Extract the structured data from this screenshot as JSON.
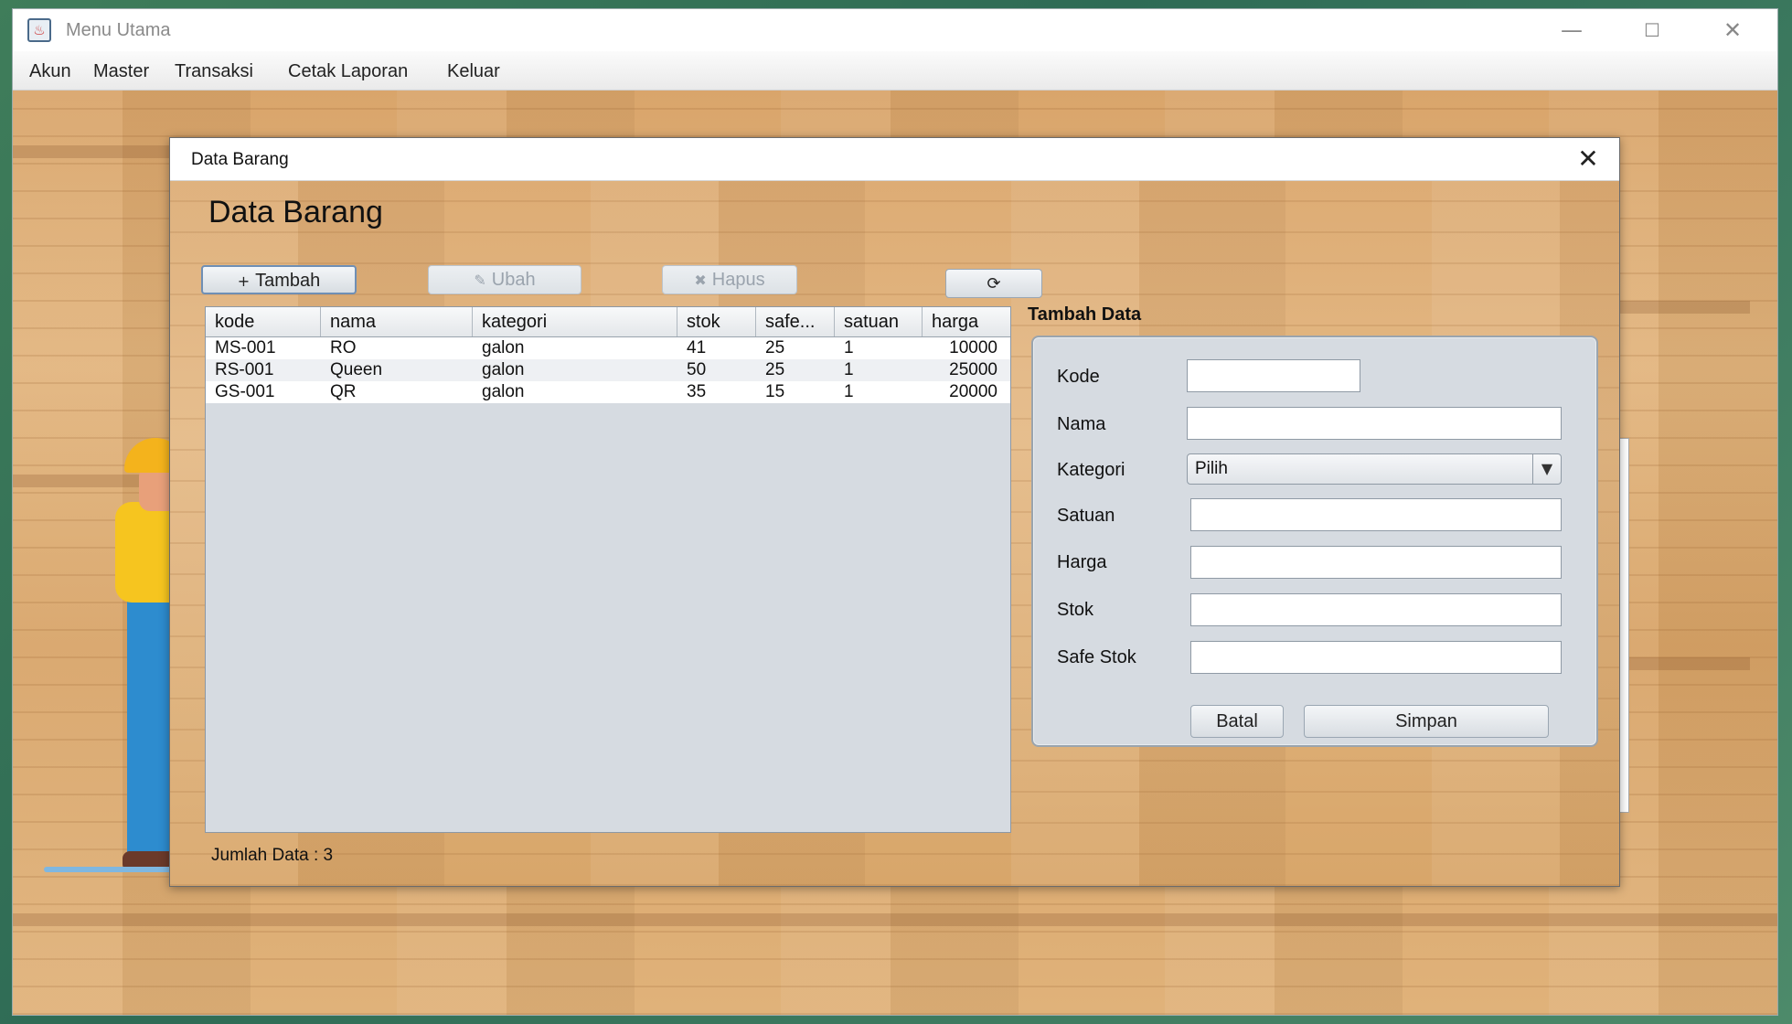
{
  "window": {
    "title": "Menu Utama",
    "minimize_glyph": "—",
    "maximize_glyph": "☐",
    "close_glyph": "✕"
  },
  "menubar": {
    "items": [
      "Akun",
      "Master",
      "Transaksi",
      "Cetak Laporan",
      "Keluar"
    ]
  },
  "dialog": {
    "title": "Data Barang",
    "close_glyph": "✕",
    "heading": "Data Barang",
    "toolbar": {
      "add_label": "Tambah",
      "add_icon": "+",
      "edit_label": "Ubah",
      "edit_icon": "✎",
      "delete_label": "Hapus",
      "delete_icon": "✖",
      "refresh_icon": "⟳"
    },
    "table": {
      "columns": [
        "kode",
        "nama",
        "kategori",
        "stok",
        "safe...",
        "satuan",
        "harga"
      ],
      "rows": [
        [
          "MS-001",
          "RO",
          "galon",
          "41",
          "25",
          "1",
          "10000"
        ],
        [
          "RS-001",
          "Queen",
          "galon",
          "50",
          "25",
          "1",
          "25000"
        ],
        [
          "GS-001",
          "QR",
          "galon",
          "35",
          "15",
          "1",
          "20000"
        ]
      ]
    },
    "count_label": "Jumlah Data : 3",
    "form": {
      "title": "Tambah Data",
      "labels": {
        "kode": "Kode",
        "nama": "Nama",
        "kategori": "Kategori",
        "satuan": "Satuan",
        "harga": "Harga",
        "stok": "Stok",
        "safe_stok": "Safe Stok"
      },
      "kategori_selected": "Pilih",
      "dropdown_glyph": "▼",
      "values": {
        "kode": "",
        "nama": "",
        "satuan": "",
        "harga": "",
        "stok": "",
        "safe_stok": ""
      },
      "cancel_label": "Batal",
      "save_label": "Simpan"
    }
  },
  "colors": {
    "accent_border": "#6f8fb5",
    "panel_bg": "#d6dbe1",
    "wood": "#dcaa72"
  }
}
